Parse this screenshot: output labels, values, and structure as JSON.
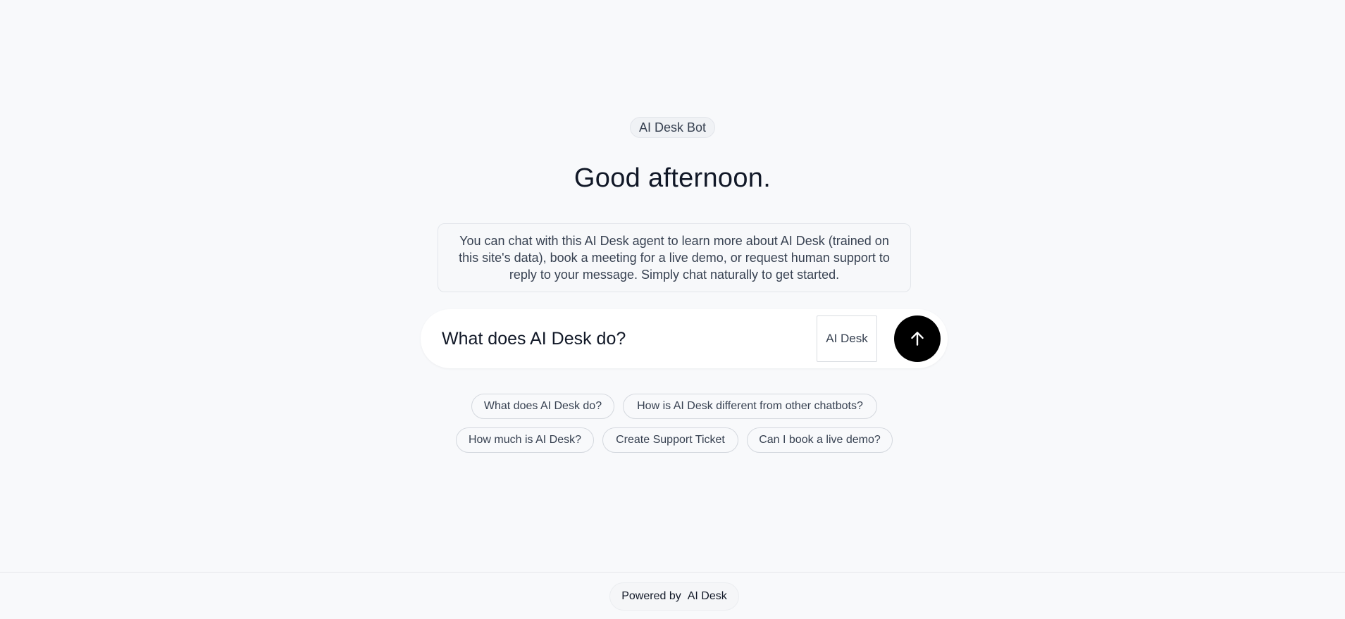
{
  "header": {
    "bot_name": "AI Desk Bot",
    "greeting": "Good afternoon."
  },
  "intro": {
    "text": "You can chat with this AI Desk agent to learn more about AI Desk (trained on this site's data), book a meeting for a live demo, or request human support to reply to your message. Simply chat naturally to get started."
  },
  "composer": {
    "placeholder": "What does AI Desk do?",
    "value": "",
    "model_label": "AI Desk",
    "send_icon": "arrow-up-icon",
    "send_button_color": "#000000"
  },
  "suggestions": [
    "What does AI Desk do?",
    "How is AI Desk different from other chatbots?",
    "How much is AI Desk?",
    "Create Support Ticket",
    "Can I book a live demo?"
  ],
  "footer": {
    "powered_by": "Powered by",
    "brand": "AI Desk"
  }
}
